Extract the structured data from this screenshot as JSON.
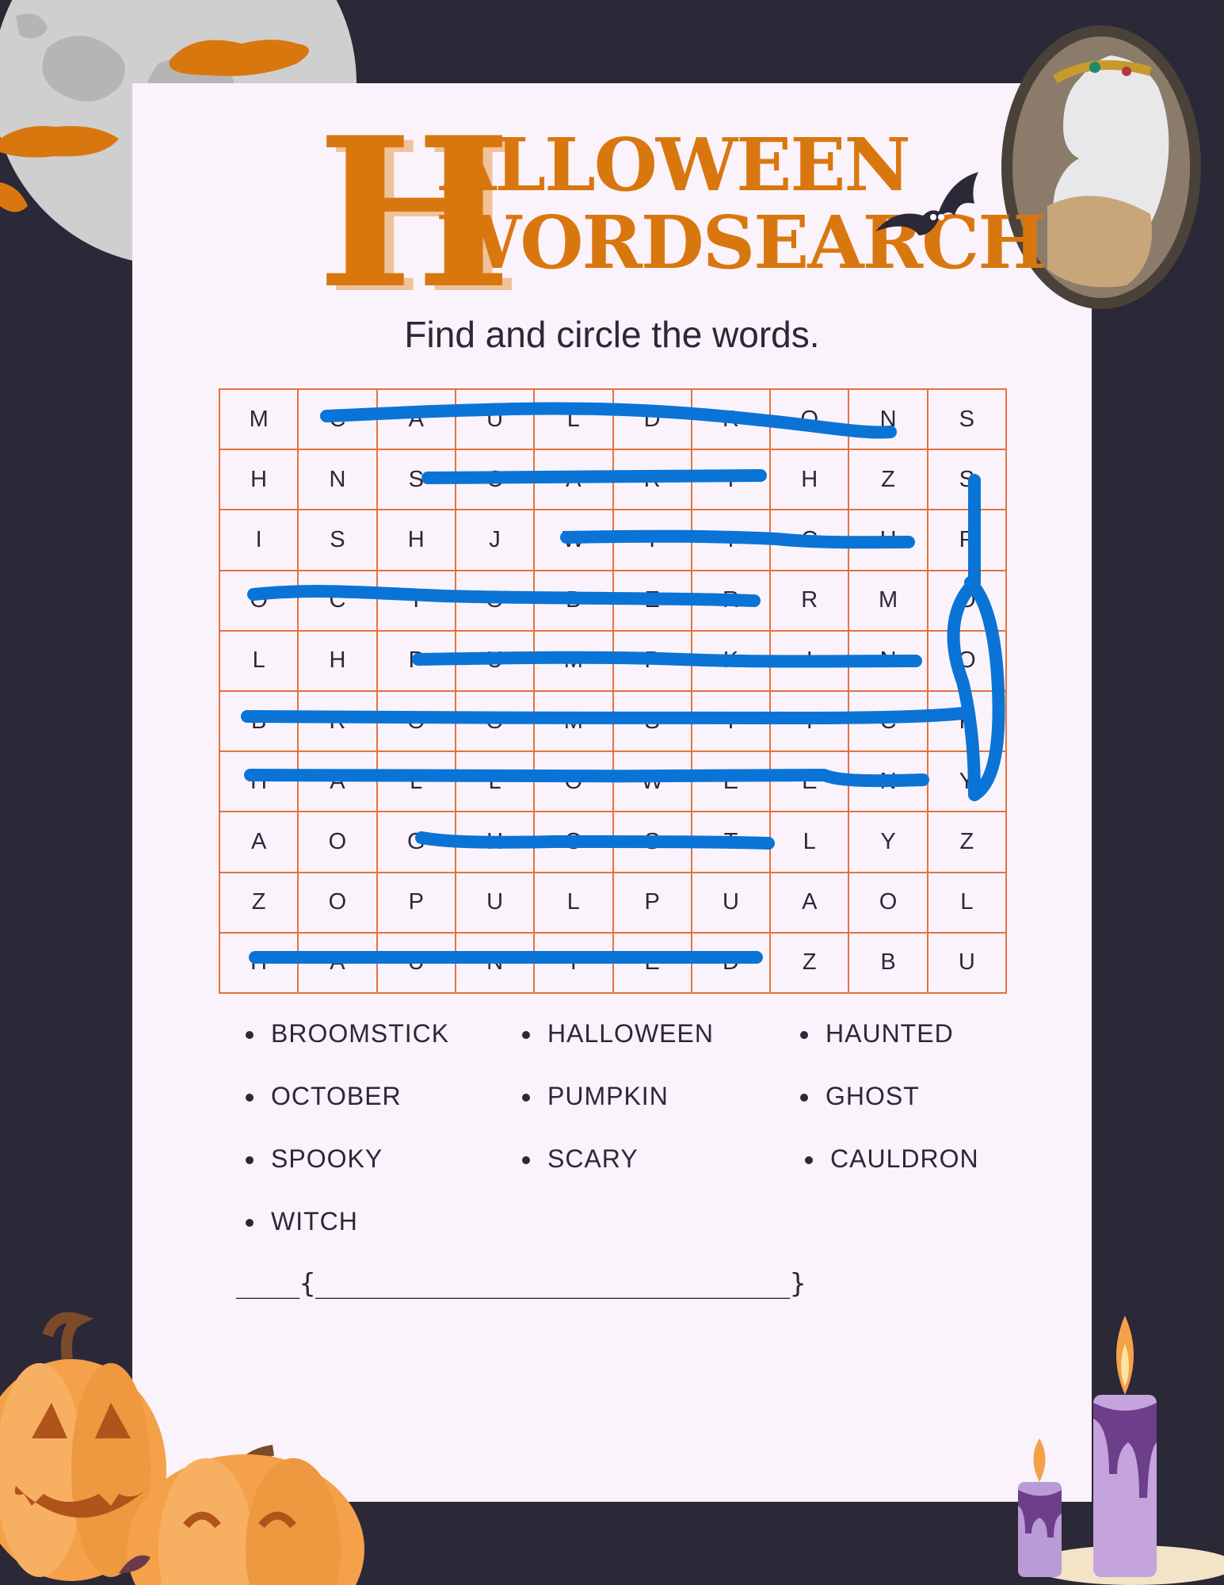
{
  "title": {
    "initial": "H",
    "line1": "ALLOWEEN",
    "line2": "WORDSEARCH"
  },
  "subtitle": "Find and circle the words.",
  "grid": [
    [
      "M",
      "C",
      "A",
      "U",
      "L",
      "D",
      "R",
      "O",
      "N",
      "S"
    ],
    [
      "H",
      "N",
      "S",
      "C",
      "A",
      "R",
      "Y",
      "H",
      "Z",
      "S"
    ],
    [
      "I",
      "S",
      "H",
      "J",
      "W",
      "I",
      "T",
      "C",
      "H",
      "P"
    ],
    [
      "O",
      "C",
      "T",
      "O",
      "B",
      "E",
      "R",
      "R",
      "M",
      "O"
    ],
    [
      "L",
      "H",
      "P",
      "U",
      "M",
      "P",
      "K",
      "I",
      "N",
      "O"
    ],
    [
      "B",
      "R",
      "O",
      "O",
      "M",
      "S",
      "T",
      "I",
      "C",
      "K"
    ],
    [
      "H",
      "A",
      "L",
      "L",
      "O",
      "W",
      "E",
      "E",
      "N",
      "Y"
    ],
    [
      "A",
      "O",
      "G",
      "H",
      "O",
      "S",
      "T",
      "L",
      "Y",
      "Z"
    ],
    [
      "Z",
      "O",
      "P",
      "U",
      "L",
      "P",
      "U",
      "A",
      "O",
      "L"
    ],
    [
      "H",
      "A",
      "U",
      "N",
      "T",
      "E",
      "D",
      "Z",
      "B",
      "U"
    ]
  ],
  "words": [
    "BROOMSTICK",
    "HALLOWEEN",
    "HAUNTED",
    "OCTOBER",
    "PUMPKIN",
    "GHOST",
    "SPOOKY",
    "SCARY",
    "CAULDRON",
    "WITCH"
  ],
  "answer_line": "____{______________________________}",
  "colors": {
    "background": "#2b2838",
    "paper": "#fbf3fb",
    "title_orange": "#d9770f",
    "grid_line": "#e2733f",
    "highlight_blue": "#0a74d6",
    "pumpkin": "#f4a14a",
    "candle": "#c5a3dc"
  },
  "icons": [
    "moon-illustration",
    "bat-icon",
    "cameo-portrait",
    "pumpkin-illustration",
    "candle-illustration"
  ]
}
